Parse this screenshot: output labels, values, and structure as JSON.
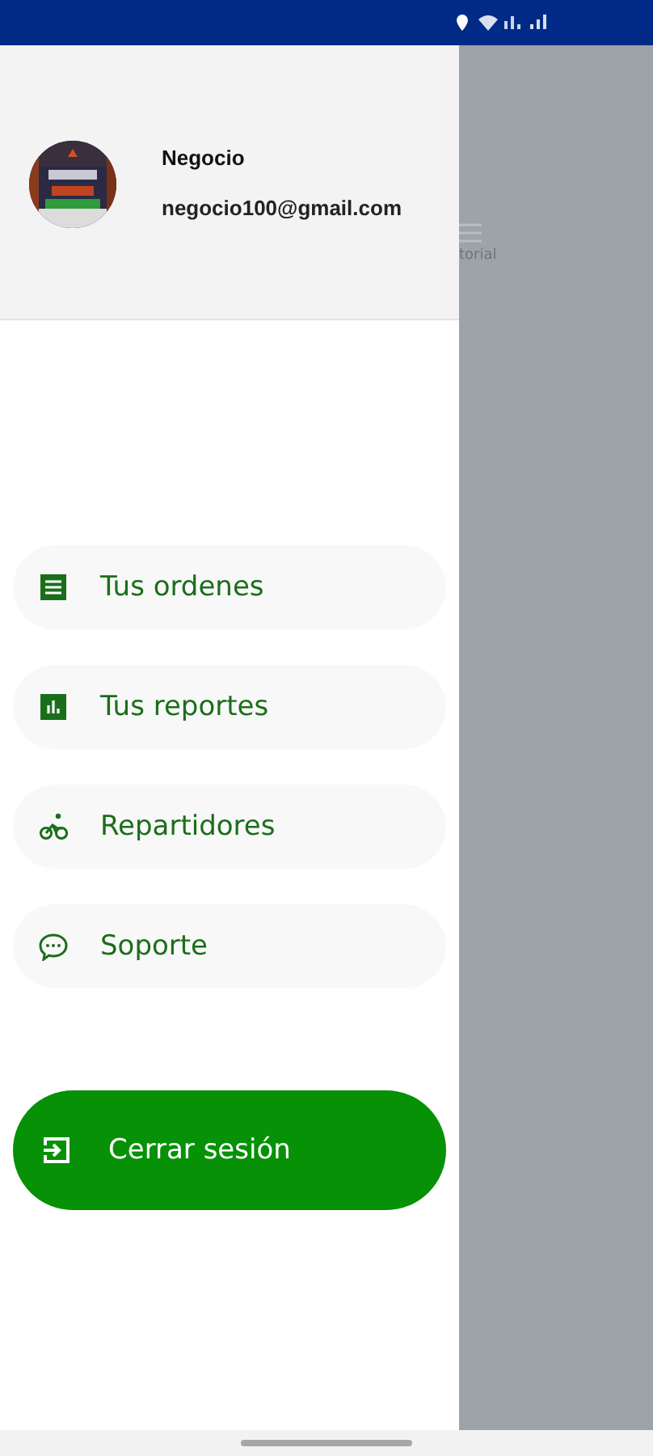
{
  "profile": {
    "name": "Negocio",
    "email": "negocio100@gmail.com"
  },
  "menu": [
    {
      "label": "Tus ordenes"
    },
    {
      "label": "Tus reportes"
    },
    {
      "label": "Repartidores"
    },
    {
      "label": "Soporte"
    }
  ],
  "logout": {
    "label": "Cerrar sesión"
  },
  "background": {
    "tab_label": "torial"
  }
}
